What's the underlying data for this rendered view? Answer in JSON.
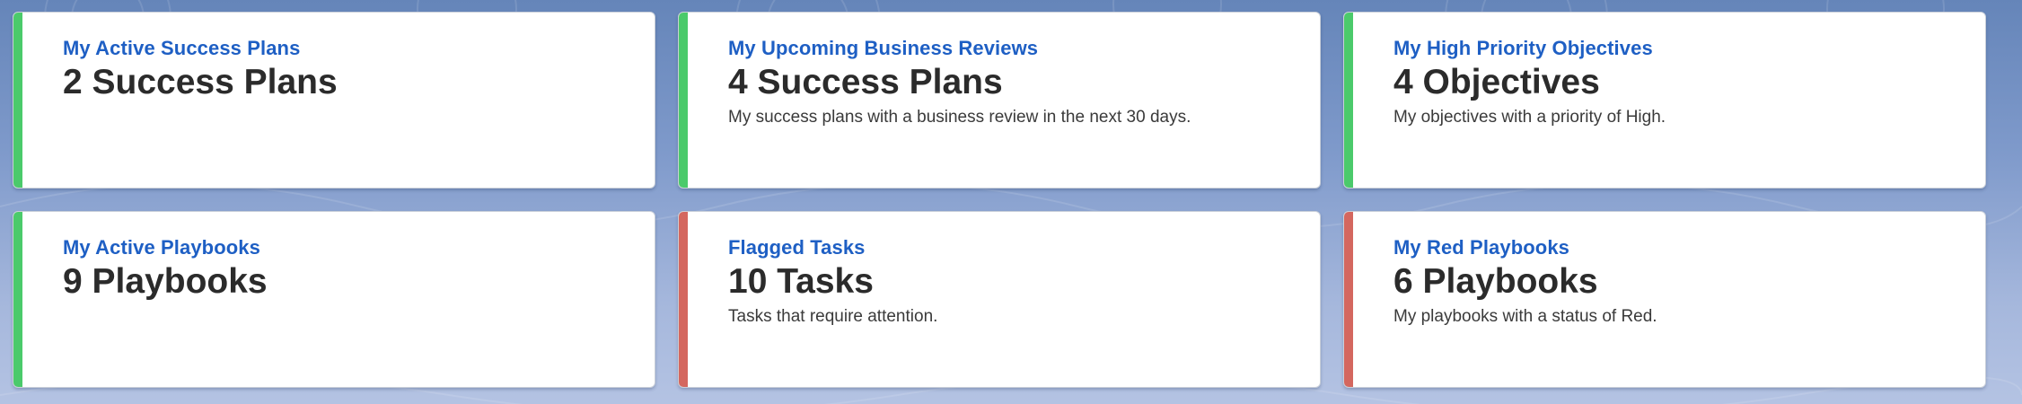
{
  "colors": {
    "title": "#1e5fc4",
    "value": "#2b2b2b",
    "stripe_green": "#4bca6b",
    "stripe_red": "#d4675f"
  },
  "cards": [
    {
      "title": "My Active Success Plans",
      "value": "2 Success Plans",
      "description": "",
      "status": "green"
    },
    {
      "title": "My Upcoming Business Reviews",
      "value": "4 Success Plans",
      "description": "My success plans with a business review in the next 30 days.",
      "status": "green"
    },
    {
      "title": "My High Priority Objectives",
      "value": "4 Objectives",
      "description": "My objectives with a priority of High.",
      "status": "green"
    },
    {
      "title": "My Active Playbooks",
      "value": "9 Playbooks",
      "description": "",
      "status": "green"
    },
    {
      "title": "Flagged Tasks",
      "value": "10 Tasks",
      "description": "Tasks that require attention.",
      "status": "red"
    },
    {
      "title": "My Red Playbooks",
      "value": "6 Playbooks",
      "description": "My playbooks with a status of Red.",
      "status": "red"
    }
  ]
}
